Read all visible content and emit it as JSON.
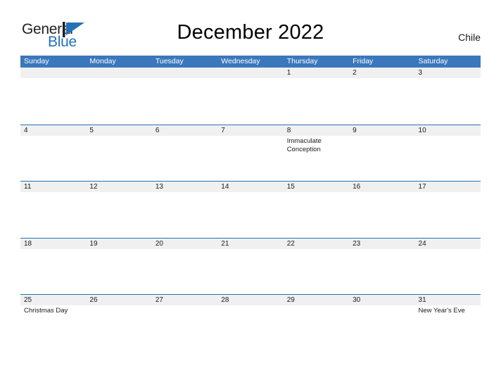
{
  "brand": {
    "name_part1": "General",
    "name_part2": "Blue",
    "flag_icon": "triangle-flag-icon",
    "color_dark": "#231f20",
    "color_blue": "#2272b8"
  },
  "header": {
    "title": "December 2022",
    "country": "Chile"
  },
  "theme": {
    "header_bar": "#3a77bc",
    "row_divider": "#2272b8",
    "date_band": "#f0f0f0",
    "text": "#1a1a1a",
    "background": "#ffffff"
  },
  "calendar": {
    "weekdays": [
      "Sunday",
      "Monday",
      "Tuesday",
      "Wednesday",
      "Thursday",
      "Friday",
      "Saturday"
    ],
    "weeks": [
      [
        {
          "day": "",
          "events": []
        },
        {
          "day": "",
          "events": []
        },
        {
          "day": "",
          "events": []
        },
        {
          "day": "",
          "events": []
        },
        {
          "day": "1",
          "events": []
        },
        {
          "day": "2",
          "events": []
        },
        {
          "day": "3",
          "events": []
        }
      ],
      [
        {
          "day": "4",
          "events": []
        },
        {
          "day": "5",
          "events": []
        },
        {
          "day": "6",
          "events": []
        },
        {
          "day": "7",
          "events": []
        },
        {
          "day": "8",
          "events": [
            "Immaculate Conception"
          ]
        },
        {
          "day": "9",
          "events": []
        },
        {
          "day": "10",
          "events": []
        }
      ],
      [
        {
          "day": "11",
          "events": []
        },
        {
          "day": "12",
          "events": []
        },
        {
          "day": "13",
          "events": []
        },
        {
          "day": "14",
          "events": []
        },
        {
          "day": "15",
          "events": []
        },
        {
          "day": "16",
          "events": []
        },
        {
          "day": "17",
          "events": []
        }
      ],
      [
        {
          "day": "18",
          "events": []
        },
        {
          "day": "19",
          "events": []
        },
        {
          "day": "20",
          "events": []
        },
        {
          "day": "21",
          "events": []
        },
        {
          "day": "22",
          "events": []
        },
        {
          "day": "23",
          "events": []
        },
        {
          "day": "24",
          "events": []
        }
      ],
      [
        {
          "day": "25",
          "events": [
            "Christmas Day"
          ]
        },
        {
          "day": "26",
          "events": []
        },
        {
          "day": "27",
          "events": []
        },
        {
          "day": "28",
          "events": []
        },
        {
          "day": "29",
          "events": []
        },
        {
          "day": "30",
          "events": []
        },
        {
          "day": "31",
          "events": [
            "New Year's Eve"
          ]
        }
      ]
    ]
  }
}
